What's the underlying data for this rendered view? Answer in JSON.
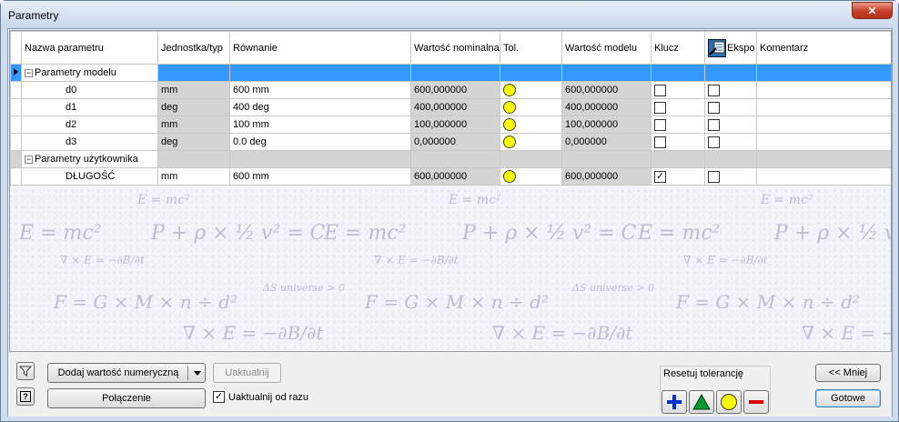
{
  "window": {
    "title": "Parametry"
  },
  "columns": [
    "Nazwa parametru",
    "Jednostka/typ",
    "Równanie",
    "Wartość nominalna",
    "Tol.",
    "Wartość modelu",
    "Klucz",
    "Ekspo",
    "Komentarz"
  ],
  "groups": [
    {
      "label": "Parametry modelu",
      "rows": [
        {
          "name": "d0",
          "unit": "mm",
          "equation": "600 mm",
          "nominal": "600,000000",
          "model": "600,000000",
          "key": false,
          "export": false
        },
        {
          "name": "d1",
          "unit": "deg",
          "equation": "400 deg",
          "nominal": "400,000000",
          "model": "400,000000",
          "key": false,
          "export": false
        },
        {
          "name": "d2",
          "unit": "mm",
          "equation": "100 mm",
          "nominal": "100,000000",
          "model": "100,000000",
          "key": false,
          "export": false
        },
        {
          "name": "d3",
          "unit": "deg",
          "equation": "0.0 deg",
          "nominal": "0,000000",
          "model": "0,000000",
          "key": false,
          "export": false
        }
      ]
    },
    {
      "label": "Parametry użytkownika",
      "rows": [
        {
          "name": "DŁUGOŚĆ",
          "unit": "mm",
          "equation": "600 mm",
          "nominal": "600,000000",
          "model": "600,000000",
          "key": true,
          "export": false
        }
      ]
    }
  ],
  "background_formulas": [
    "E = mc²",
    "P + ρ × ½ v² = C",
    "∇ × E = −∂B/∂t",
    "ΔS universe > 0",
    "F = G × M × n ÷ d²"
  ],
  "toolbar": {
    "add_numeric": "Dodaj wartość numeryczną",
    "update": "Uaktualnij",
    "link": "Połączenie",
    "auto_update_label": "Uaktualnij od razu",
    "auto_update_checked": true,
    "reset_tolerance_label": "Resetuj tolerancję",
    "less": "<< Mniej",
    "done": "Gotowe"
  },
  "tolerance_buttons": [
    {
      "icon": "plus-icon",
      "color": "#0033cc"
    },
    {
      "icon": "triangle-icon",
      "color": "#009933"
    },
    {
      "icon": "circle-icon",
      "color": "#ffff00"
    },
    {
      "icon": "minus-icon",
      "color": "#dd0000"
    }
  ]
}
